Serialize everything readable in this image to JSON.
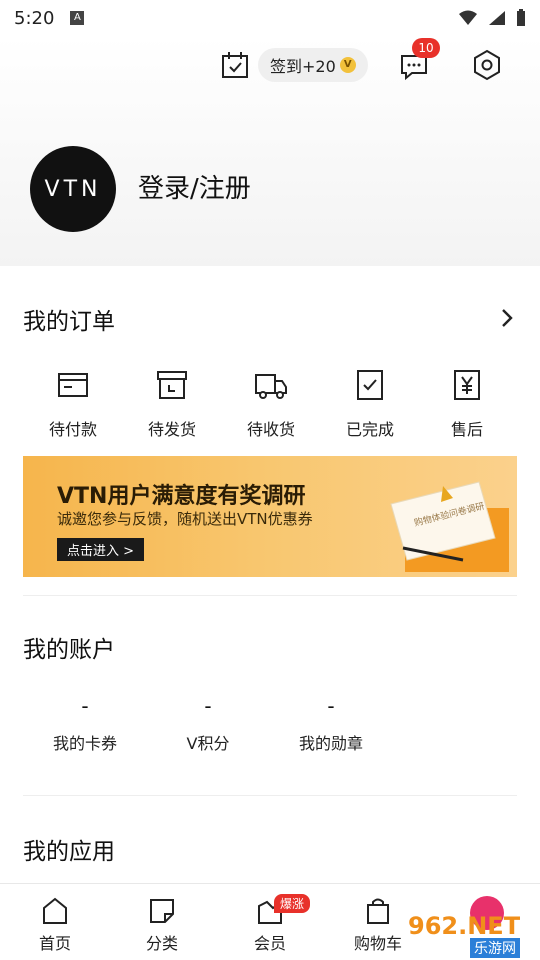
{
  "status_bar": {
    "time": "5:20",
    "notif_letter": "A"
  },
  "header": {
    "signin_label": "签到+20",
    "signin_coin": "V",
    "message_count": "10",
    "avatar_text": "VTN",
    "login_label": "登录/注册"
  },
  "orders": {
    "title": "我的订单",
    "items": [
      {
        "label": "待付款",
        "icon": "wallet-icon"
      },
      {
        "label": "待发货",
        "icon": "box-icon"
      },
      {
        "label": "待收货",
        "icon": "truck-icon"
      },
      {
        "label": "已完成",
        "icon": "check-icon"
      },
      {
        "label": "售后",
        "icon": "yen-icon"
      }
    ]
  },
  "banner": {
    "title": "VTN用户满意度有奖调研",
    "subtitle": "诚邀您参与反馈，随机送出VTN优惠券",
    "button": "点击进入 >",
    "envelope_text": "购物体验问卷调研"
  },
  "account": {
    "title": "我的账户",
    "items": [
      {
        "value": "-",
        "label": "我的卡券"
      },
      {
        "value": "-",
        "label": "V积分"
      },
      {
        "value": "-",
        "label": "我的勋章"
      }
    ]
  },
  "apps": {
    "title": "我的应用"
  },
  "tabbar": {
    "items": [
      {
        "label": "首页",
        "icon": "home-icon"
      },
      {
        "label": "分类",
        "icon": "category-icon"
      },
      {
        "label": "会员",
        "icon": "member-icon"
      },
      {
        "label": "购物车",
        "icon": "cart-icon"
      }
    ],
    "hot_badge": "爆涨"
  },
  "watermark": {
    "brand": "962.NET",
    "sub": "乐游网"
  },
  "colors": {
    "accent": "#e8312a",
    "banner": "#f6b54c"
  }
}
